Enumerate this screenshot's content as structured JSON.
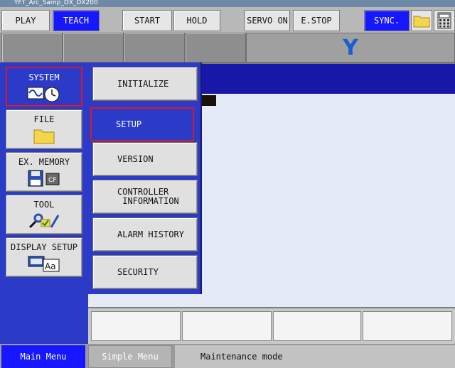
{
  "window": {
    "title": "YFT_Arc_Samp_DX_DX200"
  },
  "topbar": {
    "play": "PLAY",
    "teach": "TEACH",
    "start": "START",
    "hold": "HOLD",
    "servo_on": "SERVO ON",
    "estop": "E.STOP",
    "sync": "SYNC.",
    "folder_icon": "folder-icon",
    "calc_icon": "calculator-icon"
  },
  "status_area": {
    "axis_letter": "Y"
  },
  "left_menu": [
    {
      "label": "SYSTEM",
      "icon": "system-clock-icon",
      "selected": true
    },
    {
      "label": "FILE",
      "icon": "folder-icon",
      "selected": false
    },
    {
      "label": "EX. MEMORY",
      "icon": "floppy-cf-icon",
      "selected": false
    },
    {
      "label": "TOOL",
      "icon": "tool-icon",
      "selected": false
    },
    {
      "label": "DISPLAY SETUP",
      "icon": "display-font-icon",
      "selected": false
    }
  ],
  "sub_menu": [
    {
      "label": "INITIALIZE",
      "selected": false
    },
    {
      "label": "SETUP",
      "selected": true
    },
    {
      "label": "VERSION",
      "selected": false
    },
    {
      "label": "CONTROLLER\n INFORMATION",
      "selected": false
    },
    {
      "label": "ALARM HISTORY",
      "selected": false
    },
    {
      "label": "SECURITY",
      "selected": false
    }
  ],
  "bottom": {
    "main_menu": "Main Menu",
    "simple_menu": "Simple Menu",
    "status_text": "Maintenance mode"
  },
  "colors": {
    "accent_blue": "#1616ff",
    "menu_blue": "#2b3ac7",
    "selection_red": "#d61a2a"
  }
}
